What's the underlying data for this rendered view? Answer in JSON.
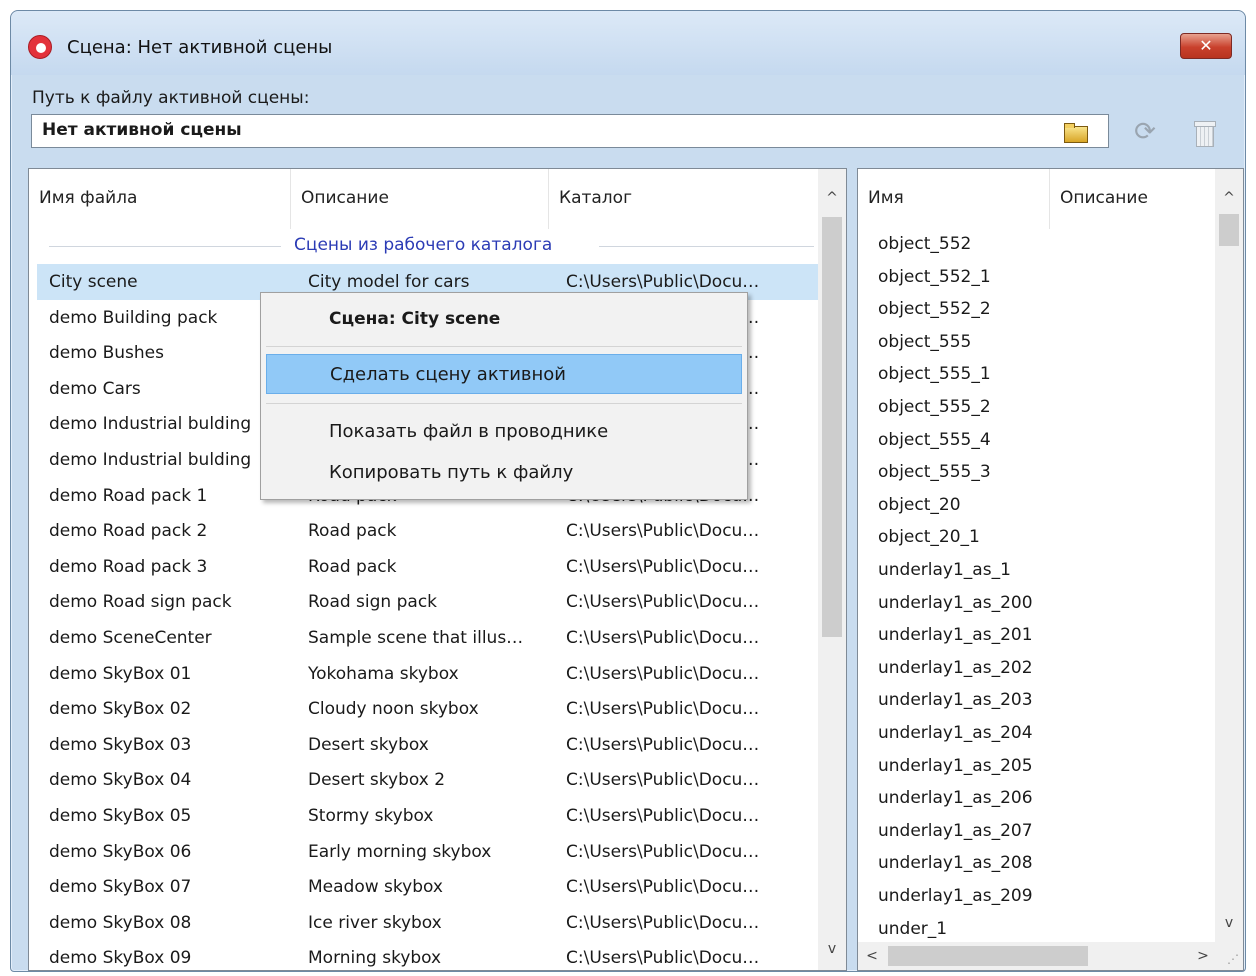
{
  "window": {
    "title": "Сцена: Нет активной сцены",
    "close_glyph": "✕"
  },
  "path": {
    "label": "Путь к файлу активной сцены:",
    "value": "Нет активной сцены"
  },
  "toolbar": {
    "refresh_glyph": "⟳"
  },
  "scenes": {
    "columns": [
      "Имя файла",
      "Описание",
      "Каталог"
    ],
    "group_label": "Сцены из рабочего каталога",
    "rows": [
      {
        "name": "City scene",
        "desc": "City model for cars",
        "path": "C:\\Users\\Public\\Docu…"
      },
      {
        "name": "demo Building pack",
        "desc": "",
        "path": "C:\\Users\\Public\\Docu…"
      },
      {
        "name": "demo Bushes",
        "desc": "",
        "path": "C:\\Users\\Public\\Docu…"
      },
      {
        "name": "demo Cars",
        "desc": "",
        "path": "C:\\Users\\Public\\Docu…"
      },
      {
        "name": "demo Industrial bulding",
        "desc": "",
        "path": "C:\\Users\\Public\\Docu…"
      },
      {
        "name": "demo Industrial bulding",
        "desc": "",
        "path": "C:\\Users\\Public\\Docu…"
      },
      {
        "name": "demo Road pack 1",
        "desc": "Road pack",
        "path": "C:\\Users\\Public\\Docu…"
      },
      {
        "name": "demo Road pack 2",
        "desc": "Road pack",
        "path": "C:\\Users\\Public\\Docu…"
      },
      {
        "name": "demo Road pack 3",
        "desc": "Road pack",
        "path": "C:\\Users\\Public\\Docu…"
      },
      {
        "name": "demo Road sign pack",
        "desc": "Road sign pack",
        "path": "C:\\Users\\Public\\Docu…"
      },
      {
        "name": "demo SceneCenter",
        "desc": "Sample scene that illus…",
        "path": "C:\\Users\\Public\\Docu…"
      },
      {
        "name": "demo SkyBox 01",
        "desc": "Yokohama skybox",
        "path": "C:\\Users\\Public\\Docu…"
      },
      {
        "name": "demo SkyBox 02",
        "desc": "Cloudy noon skybox",
        "path": "C:\\Users\\Public\\Docu…"
      },
      {
        "name": "demo SkyBox 03",
        "desc": "Desert skybox",
        "path": "C:\\Users\\Public\\Docu…"
      },
      {
        "name": "demo SkyBox 04",
        "desc": "Desert skybox 2",
        "path": "C:\\Users\\Public\\Docu…"
      },
      {
        "name": "demo SkyBox 05",
        "desc": "Stormy skybox",
        "path": "C:\\Users\\Public\\Docu…"
      },
      {
        "name": "demo SkyBox 06",
        "desc": "Early morning skybox",
        "path": "C:\\Users\\Public\\Docu…"
      },
      {
        "name": "demo SkyBox 07",
        "desc": "Meadow skybox",
        "path": "C:\\Users\\Public\\Docu…"
      },
      {
        "name": "demo SkyBox 08",
        "desc": "Ice river skybox",
        "path": "C:\\Users\\Public\\Docu…"
      },
      {
        "name": "demo SkyBox 09",
        "desc": "Morning skybox",
        "path": "C:\\Users\\Public\\Docu…"
      }
    ]
  },
  "objects": {
    "columns": [
      "Имя",
      "Описание"
    ],
    "items": [
      "object_552",
      "object_552_1",
      "object_552_2",
      "object_555",
      "object_555_1",
      "object_555_2",
      "object_555_4",
      "object_555_3",
      "object_20",
      "object_20_1",
      "underlay1_as_1",
      "underlay1_as_200",
      "underlay1_as_201",
      "underlay1_as_202",
      "underlay1_as_203",
      "underlay1_as_204",
      "underlay1_as_205",
      "underlay1_as_206",
      "underlay1_as_207",
      "underlay1_as_208",
      "underlay1_as_209",
      "under_1"
    ]
  },
  "context_menu": {
    "header": "Сцена: City scene",
    "items": [
      "Сделать сцену активной",
      "Показать файл в проводнике",
      "Копировать путь к файлу"
    ]
  },
  "scroll": {
    "up": "^",
    "down": "v",
    "left": "<",
    "right": ">",
    "grip": "⋰"
  }
}
